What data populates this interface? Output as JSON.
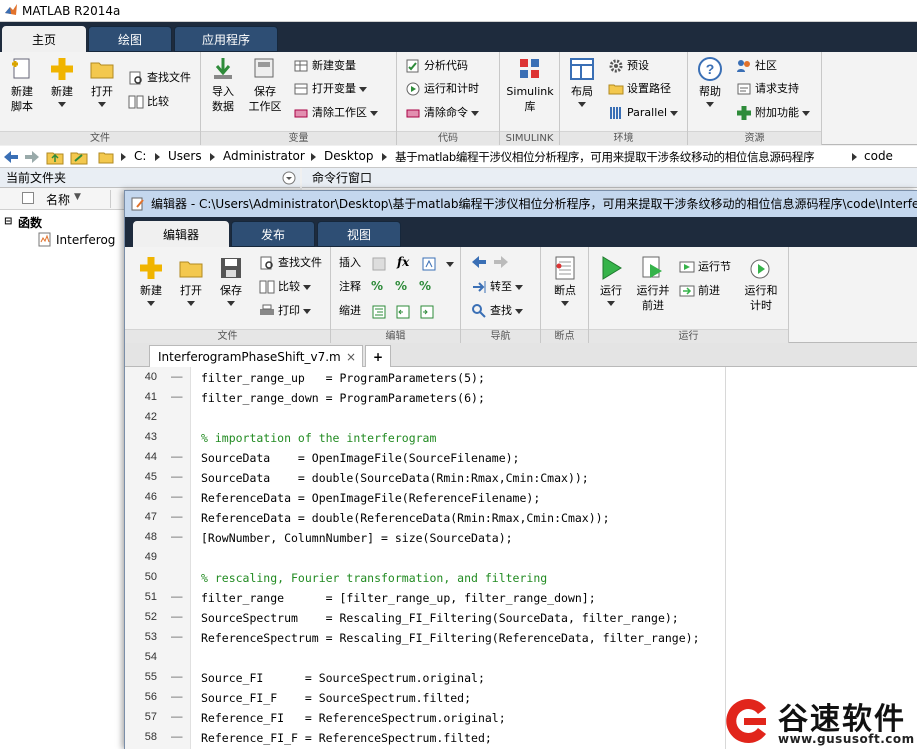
{
  "app": {
    "title": "MATLAB R2014a"
  },
  "main_tabs": [
    {
      "label": "主页",
      "active": true
    },
    {
      "label": "绘图",
      "active": false
    },
    {
      "label": "应用程序",
      "active": false
    }
  ],
  "ribbon": {
    "file": {
      "label": "文件",
      "new_script": "新建\n脚本",
      "new": "新建",
      "open": "打开",
      "find_files": "查找文件",
      "compare": "比较"
    },
    "variable": {
      "label": "变量",
      "import": "导入\n数据",
      "save_ws": "保存\n工作区",
      "new_var": "新建变量",
      "open_var": "打开变量",
      "clear_ws": "清除工作区"
    },
    "code": {
      "label": "代码",
      "analyze": "分析代码",
      "run_time": "运行和计时",
      "clear_cmd": "清除命令"
    },
    "simulink": {
      "label": "SIMULINK",
      "lib": "Simulink\n库"
    },
    "env": {
      "label": "环境",
      "layout": "布局",
      "prefs": "预设",
      "set_path": "设置路径",
      "parallel": "Parallel"
    },
    "resources": {
      "label": "资源",
      "help": "帮助",
      "community": "社区",
      "support": "请求支持",
      "addons": "附加功能"
    }
  },
  "address": {
    "segments": [
      "C:",
      "Users",
      "Administrator",
      "Desktop",
      "基于matlab编程干涉仪相位分析程序，可用来提取干涉条纹移动的相位信息源码程序",
      "code"
    ]
  },
  "left_panel": {
    "title": "当前文件夹",
    "col_name": "名称",
    "col_sort": "▼",
    "group": "函数",
    "item": "Interferog"
  },
  "cmd_window": {
    "title": "命令行窗口"
  },
  "editor": {
    "title": "编辑器 - C:\\Users\\Administrator\\Desktop\\基于matlab编程干涉仪相位分析程序，可用来提取干涉条纹移动的相位信息源码程序\\code\\Interferog",
    "tabs": [
      {
        "label": "编辑器",
        "active": true
      },
      {
        "label": "发布",
        "active": false
      },
      {
        "label": "视图",
        "active": false
      }
    ],
    "ribbon": {
      "file": {
        "label": "文件",
        "new": "新建",
        "open": "打开",
        "save": "保存",
        "find_files": "查找文件",
        "compare": "比较",
        "print": "打印"
      },
      "edit": {
        "label": "编辑",
        "insert": "插入",
        "comment": "注释",
        "indent": "缩进",
        "fx": "fx"
      },
      "nav": {
        "label": "导航",
        "goto": "转至",
        "find": "查找"
      },
      "bp": {
        "label": "断点",
        "bp": "断点"
      },
      "run": {
        "label": "运行",
        "run": "运行",
        "run_adv": "运行并\n前进",
        "run_section": "运行节",
        "advance": "前进",
        "run_time": "运行和\n计时"
      }
    },
    "file_tab": "InterferogramPhaseShift_v7.m",
    "file_close": "×",
    "add_tab": "+",
    "lines": [
      {
        "n": "40",
        "d": "—",
        "t": "filter_range_up   = ProgramParameters(5);",
        "c": false
      },
      {
        "n": "41",
        "d": "—",
        "t": "filter_range_down = ProgramParameters(6);",
        "c": false
      },
      {
        "n": "42",
        "d": "",
        "t": "",
        "c": false
      },
      {
        "n": "43",
        "d": "",
        "t": "% importation of the interferogram",
        "c": true
      },
      {
        "n": "44",
        "d": "—",
        "t": "SourceData    = OpenImageFile(SourceFilename);",
        "c": false
      },
      {
        "n": "45",
        "d": "—",
        "t": "SourceData    = double(SourceData(Rmin:Rmax,Cmin:Cmax));",
        "c": false
      },
      {
        "n": "46",
        "d": "—",
        "t": "ReferenceData = OpenImageFile(ReferenceFilename);",
        "c": false
      },
      {
        "n": "47",
        "d": "—",
        "t": "ReferenceData = double(ReferenceData(Rmin:Rmax,Cmin:Cmax));",
        "c": false
      },
      {
        "n": "48",
        "d": "—",
        "t": "[RowNumber, ColumnNumber] = size(SourceData);",
        "c": false
      },
      {
        "n": "49",
        "d": "",
        "t": "",
        "c": false
      },
      {
        "n": "50",
        "d": "",
        "t": "% rescaling, Fourier transformation, and filtering",
        "c": true
      },
      {
        "n": "51",
        "d": "—",
        "t": "filter_range      = [filter_range_up, filter_range_down];",
        "c": false
      },
      {
        "n": "52",
        "d": "—",
        "t": "SourceSpectrum    = Rescaling_FI_Filtering(SourceData, filter_range);",
        "c": false
      },
      {
        "n": "53",
        "d": "—",
        "t": "ReferenceSpectrum = Rescaling_FI_Filtering(ReferenceData, filter_range);",
        "c": false
      },
      {
        "n": "54",
        "d": "",
        "t": "",
        "c": false
      },
      {
        "n": "55",
        "d": "—",
        "t": "Source_FI      = SourceSpectrum.original;",
        "c": false
      },
      {
        "n": "56",
        "d": "—",
        "t": "Source_FI_F    = SourceSpectrum.filted;",
        "c": false
      },
      {
        "n": "57",
        "d": "—",
        "t": "Reference_FI   = ReferenceSpectrum.original;",
        "c": false
      },
      {
        "n": "58",
        "d": "—",
        "t": "Reference_FI_F = ReferenceSpectrum.filted;",
        "c": false
      }
    ]
  },
  "watermark": {
    "name": "谷速软件",
    "url": "www.gususoft.com"
  }
}
